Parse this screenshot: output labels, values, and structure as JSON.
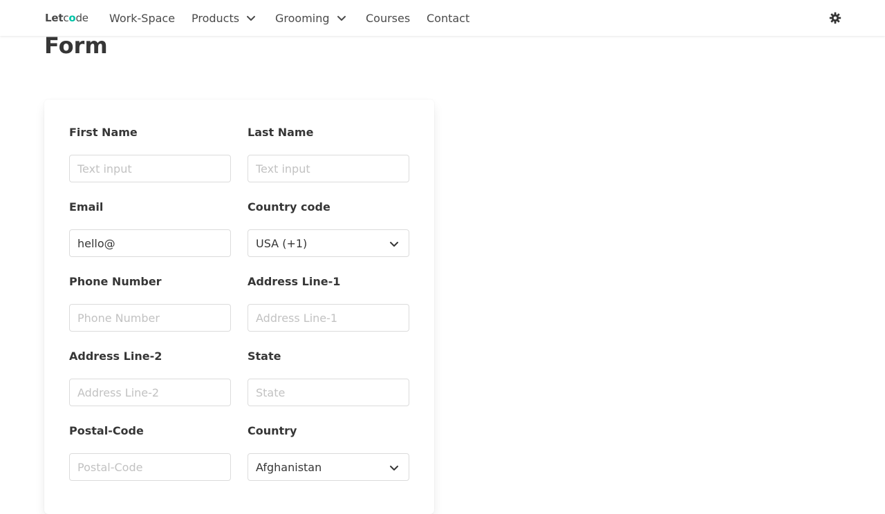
{
  "nav": {
    "logo_let": "Let",
    "logo_code": "code",
    "items": [
      "Work-Space",
      "Products",
      "Grooming",
      "Courses",
      "Contact"
    ]
  },
  "page": {
    "title": "Form"
  },
  "form": {
    "first_name": {
      "label": "First Name",
      "placeholder": "Text input",
      "value": ""
    },
    "last_name": {
      "label": "Last Name",
      "placeholder": "Text input",
      "value": ""
    },
    "email": {
      "label": "Email",
      "placeholder": "",
      "value": "hello@"
    },
    "country_code": {
      "label": "Country code",
      "selected": "USA (+1)"
    },
    "phone": {
      "label": "Phone Number",
      "placeholder": "Phone Number",
      "value": ""
    },
    "address1": {
      "label": "Address Line-1",
      "placeholder": "Address Line-1",
      "value": ""
    },
    "address2": {
      "label": "Address Line-2",
      "placeholder": "Address Line-2",
      "value": ""
    },
    "state": {
      "label": "State",
      "placeholder": "State",
      "value": ""
    },
    "postal_code": {
      "label": "Postal-Code",
      "placeholder": "Postal-Code",
      "value": ""
    },
    "country": {
      "label": "Country",
      "selected": "Afghanistan"
    }
  },
  "colors": {
    "accent": "#00c4a7",
    "text": "#363636",
    "border": "#dbdbdb",
    "placeholder": "#c2c2c2"
  },
  "icons": {
    "theme_toggle": "gear-icon",
    "dropdown": "chevron-down-icon"
  }
}
